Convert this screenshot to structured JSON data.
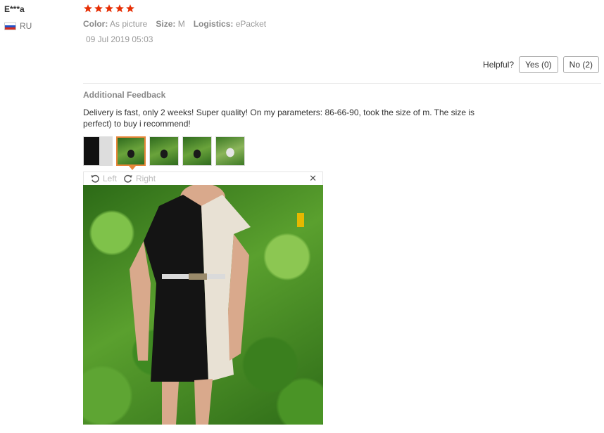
{
  "review": {
    "buyer_name": "E***a",
    "country": "RU",
    "rating": 5,
    "rating_max": 5,
    "star_color": "#e62e04",
    "meta": {
      "color_label": "Color:",
      "color_value": "As picture",
      "size_label": "Size:",
      "size_value": "M",
      "logistics_label": "Logistics:",
      "logistics_value": "ePacket"
    },
    "date": "09 Jul 2019 05:03",
    "helpful": {
      "label": "Helpful?",
      "yes": "Yes (0)",
      "no": "No (2)"
    },
    "additional": {
      "title": "Additional Feedback",
      "text": "Delivery is fast, only 2 weeks! Super quality! On my parameters: 86-66-90, took the size of m. The size is perfect) to buy i recommend!",
      "thumbnail_count": 5,
      "active_thumbnail": 2,
      "accent_color": "#e8863a"
    },
    "viewer": {
      "rotate_left": "Left",
      "rotate_right": "Right"
    }
  }
}
